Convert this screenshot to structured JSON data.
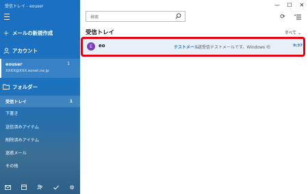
{
  "window": {
    "title": "受信トレイ - eouser"
  },
  "sidebar": {
    "new_mail": "メールの新規作成",
    "accounts_label": "アカウント",
    "account": {
      "name": "eouser",
      "email": "XXXX@XXX.eonet.ne.jp",
      "count": "1"
    },
    "folders_label": "フォルダー",
    "folders": [
      {
        "label": "受信トレイ",
        "count": "1"
      },
      {
        "label": "下書き",
        "count": ""
      },
      {
        "label": "送信済みアイテム",
        "count": ""
      },
      {
        "label": "削除済みアイテム",
        "count": ""
      },
      {
        "label": "迷惑メール",
        "count": ""
      },
      {
        "label": "その他",
        "count": ""
      }
    ]
  },
  "search": {
    "placeholder": "検索"
  },
  "list": {
    "title": "受信トレイ",
    "filter": "すべて",
    "messages": [
      {
        "avatar": "E",
        "sender": "eo",
        "subject": "テストメール",
        "preview": "送受信テストメールです。Windows の",
        "time": "9:37"
      }
    ]
  },
  "colors": {
    "accent": "#1a70c2",
    "highlight": "#e0000f",
    "avatar": "#7a3fb7"
  }
}
